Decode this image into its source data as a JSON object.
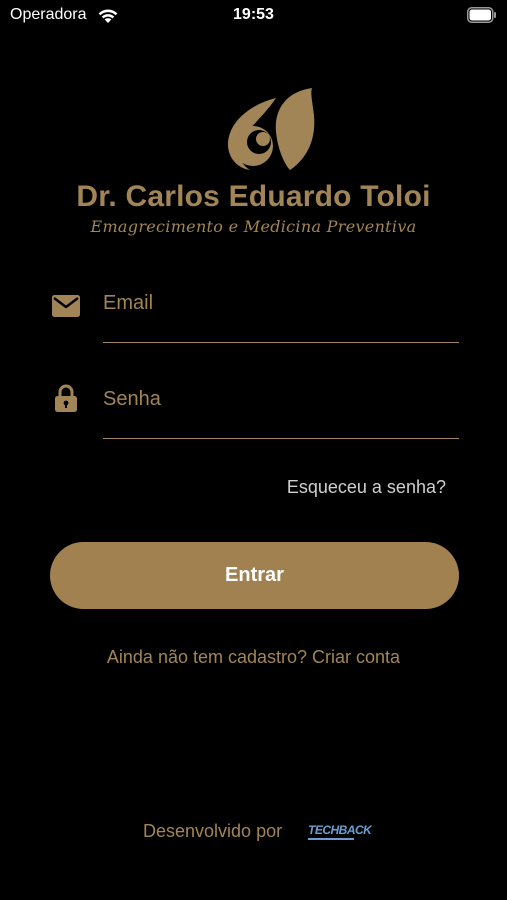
{
  "status_bar": {
    "carrier": "Operadora",
    "time": "19:53"
  },
  "logo": {
    "name": "Dr. Carlos Eduardo Toloi",
    "subtitle": "Emagrecimento e Medicina Preventiva"
  },
  "form": {
    "email": {
      "placeholder": "Email",
      "value": ""
    },
    "password": {
      "placeholder": "Senha",
      "value": ""
    },
    "forgot_label": "Esqueceu a senha?",
    "submit_label": "Entrar",
    "signup_label": "Ainda não tem cadastro? Criar conta"
  },
  "footer": {
    "developed_by": "Desenvolvido por",
    "developer_logo_text": "TECHBACK"
  },
  "colors": {
    "accent": "#a28556",
    "button": "#a1814f",
    "background": "#000000"
  }
}
